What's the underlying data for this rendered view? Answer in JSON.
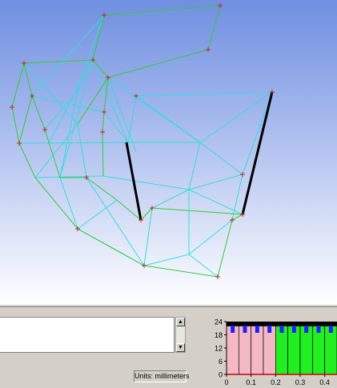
{
  "status": {
    "units_label": "Units: millimeters"
  },
  "scroll": {
    "up_icon": "arrow-up-icon",
    "down_icon": "arrow-down-icon"
  },
  "colors": {
    "wire_green": "#33cc33",
    "wire_cyan": "#33dddd",
    "marker_red": "#cc2222",
    "member_black": "#000000"
  },
  "chart_data": {
    "type": "bar",
    "title": "",
    "xlabel": "",
    "ylabel": "",
    "xlim": [
      0,
      0.45
    ],
    "ylim": [
      0,
      24
    ],
    "x_ticks": [
      "0",
      "0.1",
      "0.2",
      "0.3",
      "0.4"
    ],
    "y_ticks": [
      "0",
      "6",
      "12",
      "18",
      "24"
    ],
    "grid": true,
    "series": [
      {
        "values": [
          {
            "x0": 0.0,
            "x1": 0.05,
            "y": 22,
            "color": "#f4b8c4"
          },
          {
            "x0": 0.05,
            "x1": 0.1,
            "y": 22,
            "color": "#f4b8c4"
          },
          {
            "x0": 0.1,
            "x1": 0.15,
            "y": 22,
            "color": "#f4b8c4"
          },
          {
            "x0": 0.15,
            "x1": 0.2,
            "y": 22,
            "color": "#f4b8c4"
          },
          {
            "x0": 0.2,
            "x1": 0.25,
            "y": 22,
            "color": "#22ee22"
          },
          {
            "x0": 0.25,
            "x1": 0.3,
            "y": 22,
            "color": "#22ee22"
          },
          {
            "x0": 0.3,
            "x1": 0.35,
            "y": 22,
            "color": "#22ee22"
          },
          {
            "x0": 0.35,
            "x1": 0.4,
            "y": 22,
            "color": "#22ee22"
          },
          {
            "x0": 0.4,
            "x1": 0.45,
            "y": 22,
            "color": "#22ee22"
          }
        ]
      },
      {
        "values": [
          {
            "x": 0.025,
            "y": 20
          },
          {
            "x": 0.075,
            "y": 20
          },
          {
            "x": 0.125,
            "y": 20
          },
          {
            "x": 0.175,
            "y": 20
          },
          {
            "x": 0.225,
            "y": 20
          },
          {
            "x": 0.275,
            "y": 20
          },
          {
            "x": 0.325,
            "y": 20
          },
          {
            "x": 0.375,
            "y": 20
          },
          {
            "x": 0.425,
            "y": 20
          }
        ],
        "color": "#2020ff"
      }
    ]
  }
}
